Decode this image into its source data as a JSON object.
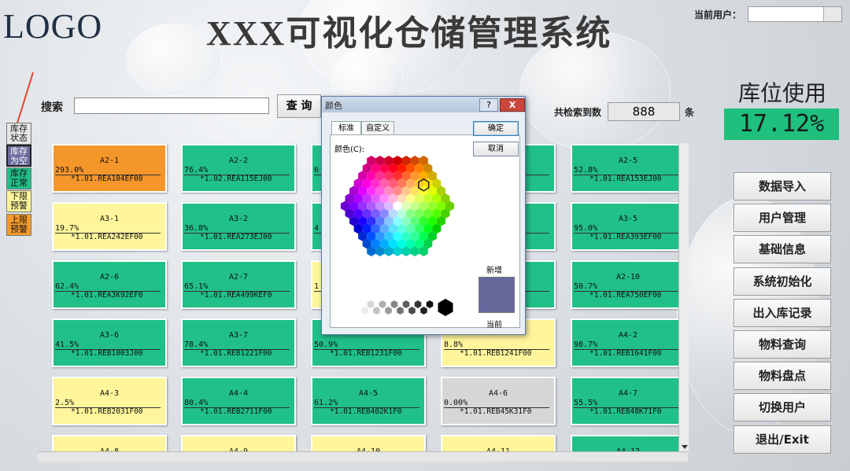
{
  "header": {
    "logo": "LOGO",
    "title": "XXX可视化仓储管理系统",
    "current_user_label": "当前用户："
  },
  "usage": {
    "title": "库位使用",
    "value": "17.12%"
  },
  "search": {
    "label": "搜索",
    "button": "查 询",
    "count_label": "共检索到数",
    "count_value": "888",
    "count_unit": "条"
  },
  "legend": [
    {
      "label": "库存\n状态",
      "color": "#e6e6e6"
    },
    {
      "label": "库存\n为空",
      "color": "#6c6c9e"
    },
    {
      "label": "库存\n正常",
      "color": "#21bf88"
    },
    {
      "label": "下限\n预警",
      "color": "#fff59a"
    },
    {
      "label": "上限\n预警",
      "color": "#f59b2c"
    }
  ],
  "sidebar": [
    "数据导入",
    "用户管理",
    "基础信息",
    "系统初始化",
    "出入库记录",
    "物料查询",
    "物料盘点",
    "切换用户",
    "退出/Exit"
  ],
  "colors": {
    "normal": "#20c088",
    "low": "#fff69c",
    "high": "#f5962a",
    "empty": "#d6d6d6"
  },
  "cells": [
    {
      "loc": "A2-1",
      "pct": "293.0%",
      "code": "*1.01.REA104EF00",
      "status": "high"
    },
    {
      "loc": "A2-2",
      "pct": "76.4%",
      "code": "*1.02.REA115EJ00",
      "status": "normal"
    },
    {
      "loc": "",
      "pct": "6",
      "code": "",
      "status": "normal"
    },
    {
      "loc": "",
      "pct": "",
      "code": "F0",
      "status": "normal"
    },
    {
      "loc": "A2-5",
      "pct": "52.8%",
      "code": "*1.01.REA153EJ00",
      "status": "normal"
    },
    {
      "loc": "A3-1",
      "pct": "19.7%",
      "code": "*1.01.REA242EF00",
      "status": "low"
    },
    {
      "loc": "A3-2",
      "pct": "36.8%",
      "code": "*1.01.REA273EJ00",
      "status": "normal"
    },
    {
      "loc": "",
      "pct": "4",
      "code": "",
      "status": "normal"
    },
    {
      "loc": "",
      "pct": "",
      "code": "F0",
      "status": "normal"
    },
    {
      "loc": "A3-5",
      "pct": "95.0%",
      "code": "*1.01.REA393EF00",
      "status": "normal"
    },
    {
      "loc": "A2-6",
      "pct": "62.4%",
      "code": "*1.01.REA3K92EF0",
      "status": "normal"
    },
    {
      "loc": "A2-7",
      "pct": "65.1%",
      "code": "*1.01.REA499KEF0",
      "status": "normal"
    },
    {
      "loc": "",
      "pct": "1",
      "code": "",
      "status": "low"
    },
    {
      "loc": "",
      "pct": "",
      "code": "F0",
      "status": "normal"
    },
    {
      "loc": "A2-10",
      "pct": "50.7%",
      "code": "*1.01.REA750EF00",
      "status": "normal"
    },
    {
      "loc": "A3-6",
      "pct": "41.5%",
      "code": "*1.01.REB1003J00",
      "status": "normal"
    },
    {
      "loc": "A3-7",
      "pct": "78.4%",
      "code": "*1.01.REB1221F00",
      "status": "normal"
    },
    {
      "loc": "",
      "pct": "50.9%",
      "code": "*1.01.REB1231F00",
      "status": "normal"
    },
    {
      "loc": "",
      "pct": "8.8%",
      "code": "*1.01.REB1241F00",
      "status": "low"
    },
    {
      "loc": "A4-2",
      "pct": "98.7%",
      "code": "*1.01.REB1641F00",
      "status": "normal"
    },
    {
      "loc": "A4-3",
      "pct": "2.5%",
      "code": "*1.01.REB2031F00",
      "status": "low"
    },
    {
      "loc": "A4-4",
      "pct": "80.4%",
      "code": "*1.01.REB2711F00",
      "status": "normal"
    },
    {
      "loc": "A4-5",
      "pct": "61.2%",
      "code": "*1.01.REB402K1F0",
      "status": "normal"
    },
    {
      "loc": "A4-6",
      "pct": "0.00%",
      "code": "*1.01.REB45K31F0",
      "status": "empty"
    },
    {
      "loc": "A4-7",
      "pct": "55.5%",
      "code": "*1.01.REB48K71F0",
      "status": "normal"
    },
    {
      "loc": "A4-8",
      "pct": "",
      "code": "",
      "status": "low"
    },
    {
      "loc": "A4-9",
      "pct": "",
      "code": "",
      "status": "low"
    },
    {
      "loc": "A4-10",
      "pct": "",
      "code": "",
      "status": "low"
    },
    {
      "loc": "A4-11",
      "pct": "",
      "code": "",
      "status": "low"
    },
    {
      "loc": "A4-12",
      "pct": "",
      "code": "",
      "status": "normal"
    }
  ],
  "color_dialog": {
    "title": "颜色",
    "help": "?",
    "close": "X",
    "tab_standard": "标准",
    "tab_custom": "自定义",
    "colors_label": "颜色(C):",
    "ok": "确定",
    "cancel": "取消",
    "new_label": "新增",
    "current_label": "当前",
    "new_color": "#68679c"
  }
}
